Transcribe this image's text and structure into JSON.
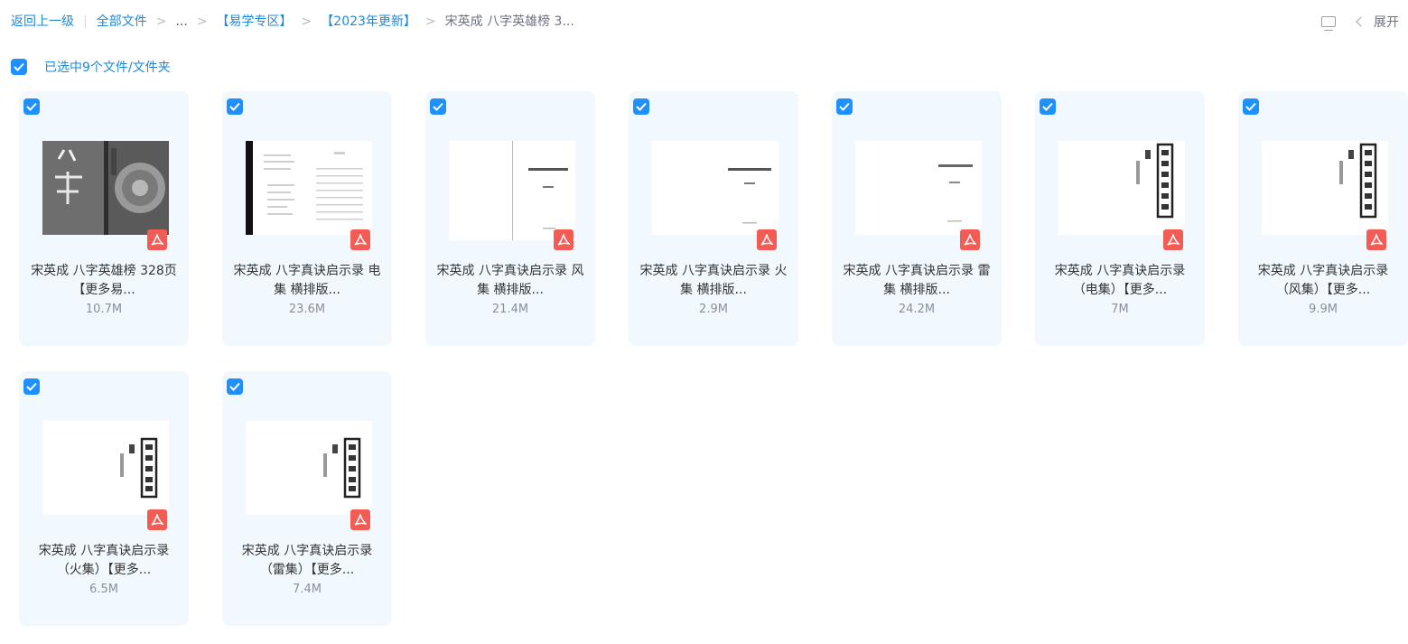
{
  "breadcrumb": {
    "back": "返回上一级",
    "all_files": "全部文件",
    "ellipsis": "...",
    "folder1": "【易学专区】",
    "folder2": "【2023年更新】",
    "current": "宋英成 八字英雄榜 3..."
  },
  "toolbar": {
    "expand_label": "展开"
  },
  "selection": {
    "text": "已选中9个文件/文件夹"
  },
  "accent_color": "#1e90ff",
  "pdf_color": "#f25c54",
  "files": [
    {
      "name": "宋英成 八字英雄榜 328页【更多易...",
      "size": "10.7M",
      "icon": "pdf-icon"
    },
    {
      "name": "宋英成 八字真诀启示录 电集 横排版...",
      "size": "23.6M",
      "icon": "pdf-icon"
    },
    {
      "name": "宋英成 八字真诀启示录 风集 横排版...",
      "size": "21.4M",
      "icon": "pdf-icon"
    },
    {
      "name": "宋英成 八字真诀启示录 火集 横排版...",
      "size": "2.9M",
      "icon": "pdf-icon"
    },
    {
      "name": "宋英成 八字真诀启示录 雷集 横排版...",
      "size": "24.2M",
      "icon": "pdf-icon"
    },
    {
      "name": "宋英成 八字真诀启示录（电集）【更多...",
      "size": "7M",
      "icon": "pdf-icon"
    },
    {
      "name": "宋英成 八字真诀启示录（风集）【更多...",
      "size": "9.9M",
      "icon": "pdf-icon"
    },
    {
      "name": "宋英成 八字真诀启示录（火集）【更多...",
      "size": "6.5M",
      "icon": "pdf-icon"
    },
    {
      "name": "宋英成 八字真诀启示录（雷集）【更多...",
      "size": "7.4M",
      "icon": "pdf-icon"
    }
  ]
}
